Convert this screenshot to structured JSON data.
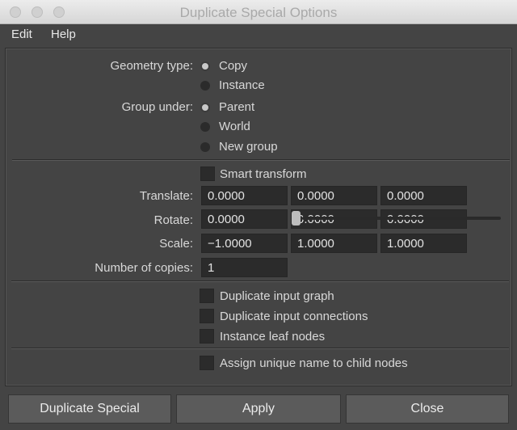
{
  "window": {
    "title": "Duplicate Special Options"
  },
  "menu": {
    "items": [
      "Edit",
      "Help"
    ]
  },
  "geometry_type": {
    "label": "Geometry type:",
    "options": [
      "Copy",
      "Instance"
    ],
    "selected": "Copy"
  },
  "group_under": {
    "label": "Group under:",
    "options": [
      "Parent",
      "World",
      "New group"
    ],
    "selected": "Parent"
  },
  "smart_transform": {
    "label": "Smart transform",
    "checked": false
  },
  "translate": {
    "label": "Translate:",
    "values": [
      "0.0000",
      "0.0000",
      "0.0000"
    ]
  },
  "rotate": {
    "label": "Rotate:",
    "values": [
      "0.0000",
      "0.0000",
      "0.0000"
    ]
  },
  "scale": {
    "label": "Scale:",
    "values": [
      "−1.0000",
      "1.0000",
      "1.0000"
    ]
  },
  "copies": {
    "label": "Number of copies:",
    "value": "1"
  },
  "options": {
    "duplicate_input_graph": "Duplicate input graph",
    "duplicate_input_connections": "Duplicate input connections",
    "instance_leaf_nodes": "Instance leaf nodes",
    "assign_unique_name": "Assign unique name to child nodes"
  },
  "buttons": {
    "duplicate_special": "Duplicate Special",
    "apply": "Apply",
    "close": "Close"
  }
}
